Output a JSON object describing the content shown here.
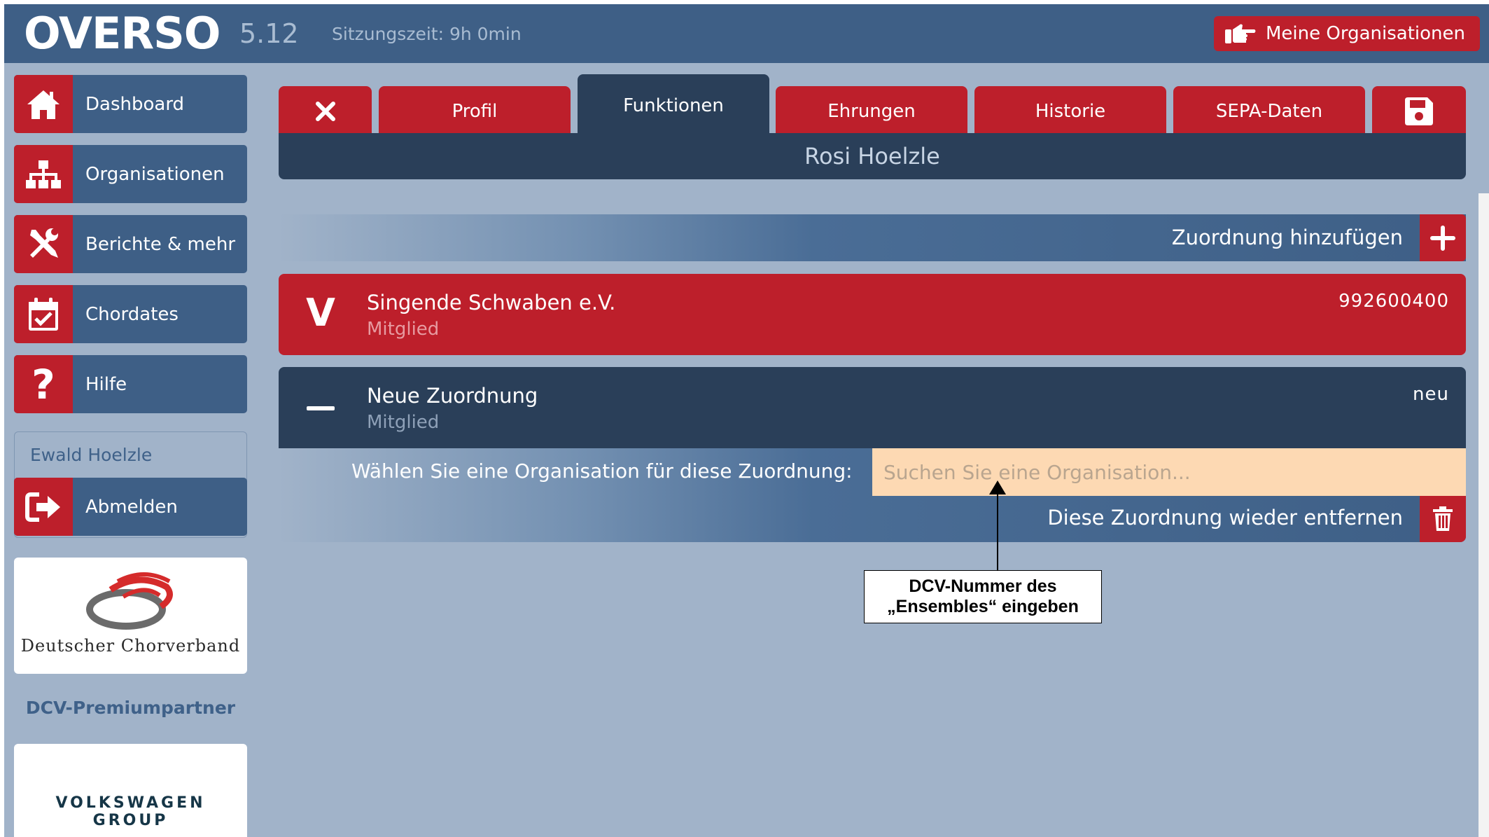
{
  "header": {
    "logo_text": "OVERSO",
    "version": "5.12",
    "session_time": "Sitzungszeit: 9h 0min",
    "my_orgs_label": "Meine Organisationen"
  },
  "sidebar": {
    "items": [
      {
        "label": "Dashboard",
        "icon": "home-icon"
      },
      {
        "label": "Organisationen",
        "icon": "org-chart-icon"
      },
      {
        "label": "Berichte & mehr",
        "icon": "tools-icon"
      },
      {
        "label": "Chordates",
        "icon": "calendar-check-icon"
      },
      {
        "label": "Hilfe",
        "icon": "question-icon"
      }
    ],
    "user_name": "Ewald Hoelzle",
    "logout_label": "Abmelden",
    "dcv_logo_text": "Deutscher Chorverband",
    "partner_label": "DCV-Premiumpartner",
    "vw_logo_text": "VOLKSWAGEN GROUP"
  },
  "tabs": {
    "items": [
      "Profil",
      "Funktionen",
      "Ehrungen",
      "Historie",
      "SEPA-Daten"
    ],
    "active": "Funktionen"
  },
  "person_name": "Rosi Hoelzle",
  "assignments": {
    "add_label": "Zuordnung hinzufügen",
    "cards": [
      {
        "letter": "V",
        "title": "Singende Schwaben e.V.",
        "role": "Mitglied",
        "number": "992600400"
      },
      {
        "title": "Neue Zuordnung",
        "role": "Mitglied",
        "number": "neu"
      }
    ],
    "choose_label": "Wählen Sie eine Organisation für diese Zuordnung:",
    "search_placeholder": "Suchen Sie eine Organisation...",
    "search_value": "",
    "remove_label": "Diese Zuordnung wieder entfernen"
  },
  "annotation": {
    "line1": "DCV-Nummer des",
    "line2": "„Ensembles“ eingeben"
  },
  "colors": {
    "accent_red": "#bd1f2b",
    "nav_blue": "#3e5f86",
    "dark_navy": "#2a3f59",
    "background": "#a1b3c9",
    "search_bg": "#fdd9b3"
  }
}
